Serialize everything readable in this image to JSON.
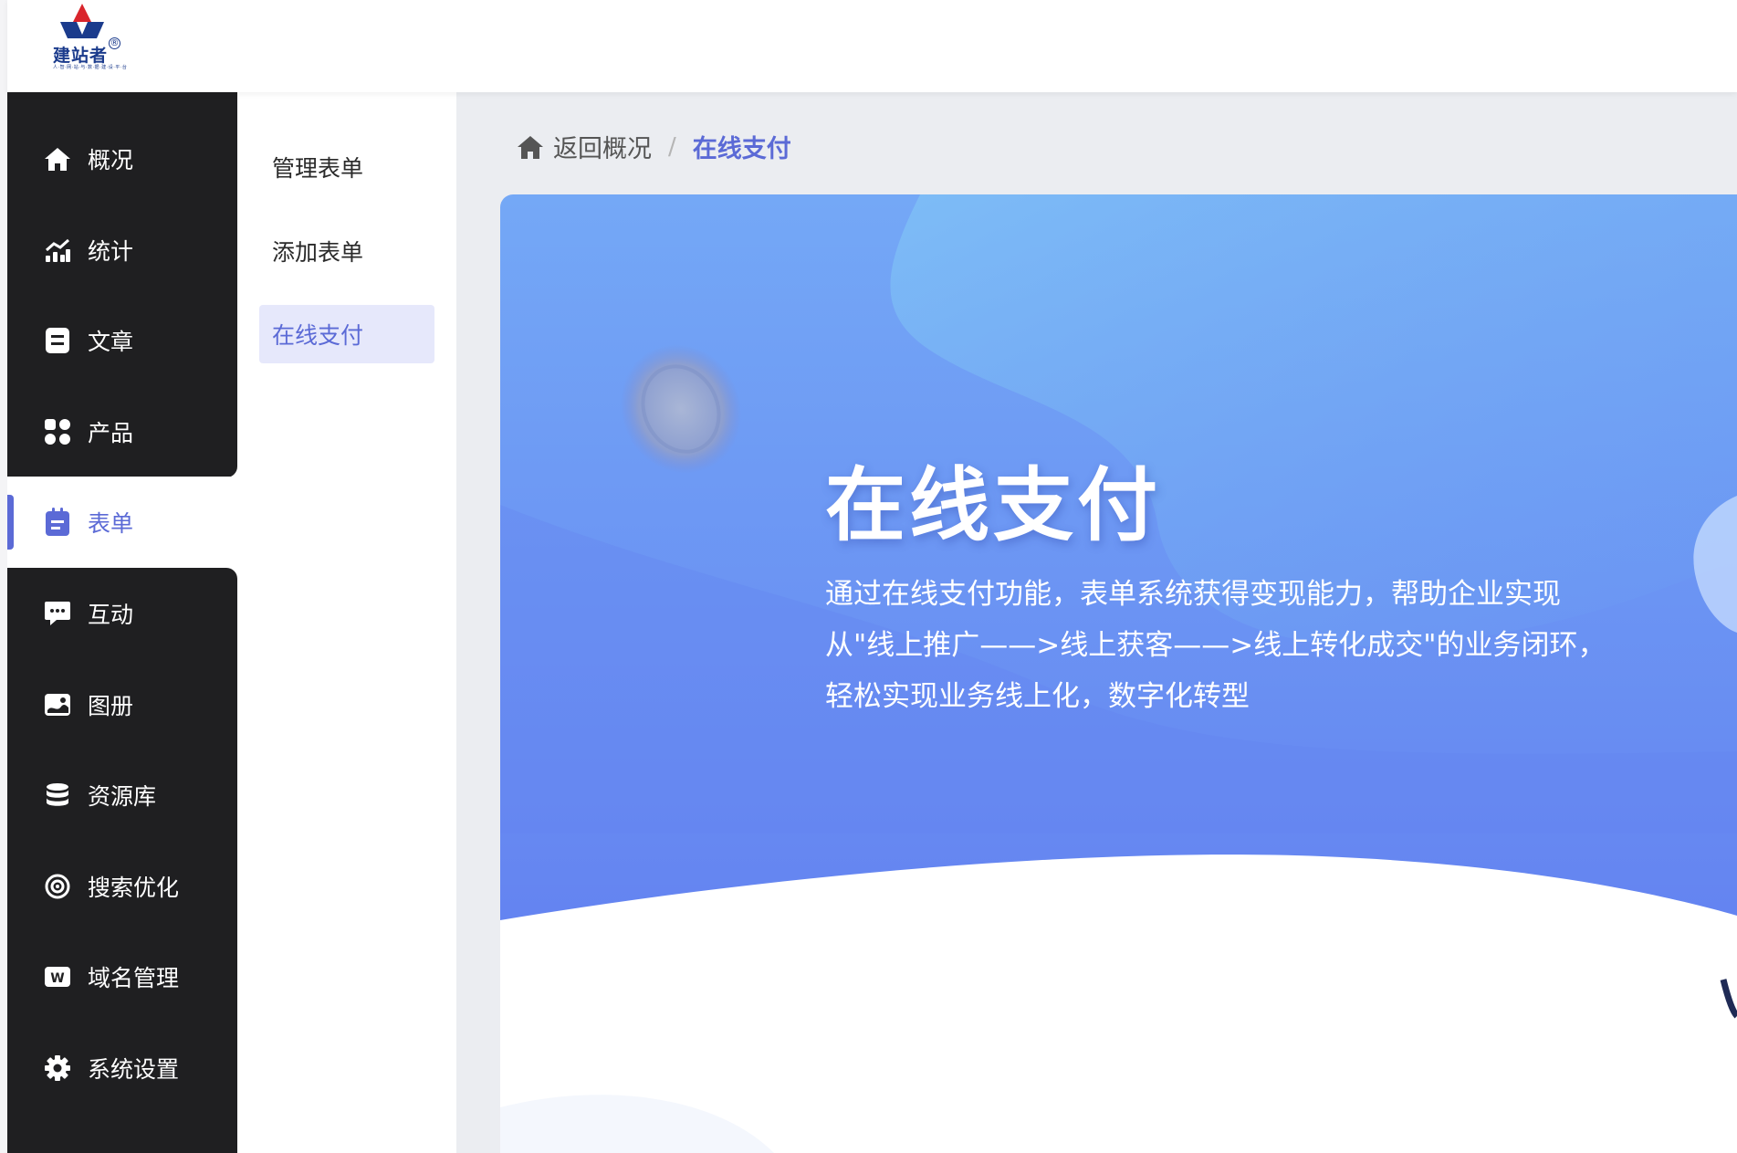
{
  "brand": {
    "logo_text": "建站者",
    "logo_mark": "®",
    "logo_subtitle": "人·智·网·站·与·数·据·建·设·平·台"
  },
  "sidebar": {
    "items": [
      {
        "label": "概况",
        "icon": "home-icon"
      },
      {
        "label": "统计",
        "icon": "chart-icon"
      },
      {
        "label": "文章",
        "icon": "article-icon"
      },
      {
        "label": "产品",
        "icon": "grid-icon"
      },
      {
        "label": "表单",
        "icon": "clipboard-icon",
        "active": true
      },
      {
        "label": "互动",
        "icon": "chat-icon"
      },
      {
        "label": "图册",
        "icon": "album-icon"
      },
      {
        "label": "资源库",
        "icon": "database-icon"
      },
      {
        "label": "搜索优化",
        "icon": "target-icon"
      },
      {
        "label": "域名管理",
        "icon": "domain-icon"
      },
      {
        "label": "系统设置",
        "icon": "gear-icon"
      }
    ]
  },
  "submenu": {
    "items": [
      {
        "label": "管理表单"
      },
      {
        "label": "添加表单"
      },
      {
        "label": "在线支付",
        "active": true
      }
    ]
  },
  "breadcrumb": {
    "home_label": "返回概况",
    "separator": "/",
    "current": "在线支付"
  },
  "hero": {
    "title": "在线支付",
    "description": "通过在线支付功能，表单系统获得变现能力，帮助企业实现从\"线上推广——>线上获客——>线上转化成交\"的业务闭环，轻松实现业务线上化，数字化转型"
  },
  "colors": {
    "accent": "#5b6ad6",
    "sidebar_bg": "#1f1f21",
    "banner_top": "#74a8f6",
    "banner_bottom": "#5f78ef",
    "active_sub_bg": "#e6e8fb"
  }
}
